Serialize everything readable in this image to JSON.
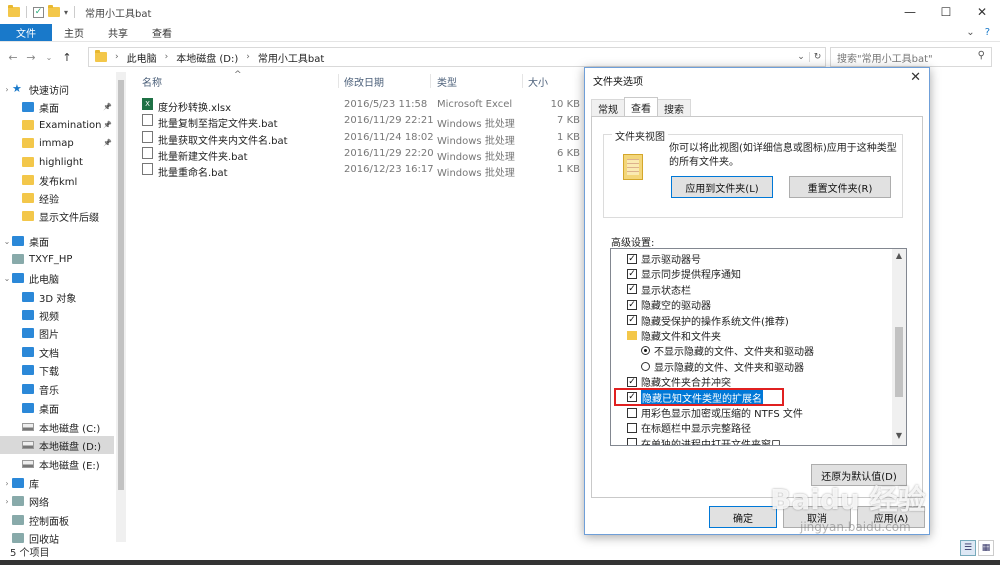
{
  "window": {
    "title": "常用小工具bat",
    "controls": {
      "minimize": "—",
      "maximize": "☐",
      "close": "✕"
    }
  },
  "ribbon": {
    "tabs": [
      "文件",
      "主页",
      "共享",
      "查看"
    ],
    "collapse": "⌄",
    "help": "?"
  },
  "address": {
    "crumbs": [
      "此电脑",
      "本地磁盘 (D:)",
      "常用小工具bat"
    ],
    "dropdown": "⌄",
    "refresh": "↻",
    "search_placeholder": "搜索\"常用小工具bat\""
  },
  "sidebar": {
    "items": [
      {
        "label": "快速访问",
        "icon": "star-icon"
      },
      {
        "label": "桌面",
        "icon": "desktop-icon",
        "pinned": true
      },
      {
        "label": "Examination",
        "icon": "folder-icon",
        "pinned": true
      },
      {
        "label": "immap",
        "icon": "folder-icon",
        "pinned": true
      },
      {
        "label": "highlight",
        "icon": "folder-icon"
      },
      {
        "label": "发布kml",
        "icon": "folder-icon"
      },
      {
        "label": "经验",
        "icon": "folder-icon"
      },
      {
        "label": "显示文件后缀",
        "icon": "folder-icon"
      },
      {
        "label": "桌面",
        "icon": "desktop-icon"
      },
      {
        "label": "TXYF_HP",
        "icon": "user-icon"
      },
      {
        "label": "此电脑",
        "icon": "computer-icon"
      },
      {
        "label": "3D 对象",
        "icon": "3d-objects-icon"
      },
      {
        "label": "视频",
        "icon": "video-icon"
      },
      {
        "label": "图片",
        "icon": "pictures-icon"
      },
      {
        "label": "文档",
        "icon": "documents-icon"
      },
      {
        "label": "下载",
        "icon": "download-icon"
      },
      {
        "label": "音乐",
        "icon": "music-icon"
      },
      {
        "label": "桌面",
        "icon": "desktop-icon"
      },
      {
        "label": "本地磁盘 (C:)",
        "icon": "drive-icon"
      },
      {
        "label": "本地磁盘 (D:)",
        "icon": "drive-icon",
        "selected": true
      },
      {
        "label": "本地磁盘 (E:)",
        "icon": "drive-icon"
      },
      {
        "label": "库",
        "icon": "library-icon"
      },
      {
        "label": "网络",
        "icon": "network-icon"
      },
      {
        "label": "控制面板",
        "icon": "control-panel-icon"
      },
      {
        "label": "回收站",
        "icon": "recycle-bin-icon"
      }
    ]
  },
  "filelist": {
    "columns": {
      "name": "名称",
      "date": "修改日期",
      "type": "类型",
      "size": "大小"
    },
    "rows": [
      {
        "name": "度分秒转换.xlsx",
        "date": "2016/5/23 11:58",
        "type": "Microsoft Excel",
        "size": "10 KB",
        "icon": "excel-icon"
      },
      {
        "name": "批量复制至指定文件夹.bat",
        "date": "2016/11/29 22:21",
        "type": "Windows 批处理",
        "size": "7 KB",
        "icon": "bat-icon"
      },
      {
        "name": "批量获取文件夹内文件名.bat",
        "date": "2016/11/24 18:02",
        "type": "Windows 批处理",
        "size": "1 KB",
        "icon": "bat-icon"
      },
      {
        "name": "批量新建文件夹.bat",
        "date": "2016/11/29 22:20",
        "type": "Windows 批处理",
        "size": "6 KB",
        "icon": "bat-icon"
      },
      {
        "name": "批量重命名.bat",
        "date": "2016/12/23 16:17",
        "type": "Windows 批处理",
        "size": "1 KB",
        "icon": "bat-icon"
      }
    ]
  },
  "status": {
    "count": "5 个项目"
  },
  "dialog": {
    "title": "文件夹选项",
    "close": "✕",
    "tabs": [
      "常规",
      "查看",
      "搜索"
    ],
    "active_tab": "查看",
    "folder_view": {
      "title": "文件夹视图",
      "description": "你可以将此视图(如详细信息或图标)应用于这种类型的所有文件夹。",
      "apply_button": "应用到文件夹(L)",
      "reset_button": "重置文件夹(R)"
    },
    "advanced_label": "高级设置:",
    "settings": [
      {
        "kind": "checkbox",
        "checked": true,
        "label": "显示驱动器号"
      },
      {
        "kind": "checkbox",
        "checked": true,
        "label": "显示同步提供程序通知"
      },
      {
        "kind": "checkbox",
        "checked": true,
        "label": "显示状态栏"
      },
      {
        "kind": "checkbox",
        "checked": true,
        "label": "隐藏空的驱动器"
      },
      {
        "kind": "checkbox",
        "checked": true,
        "label": "隐藏受保护的操作系统文件(推荐)"
      },
      {
        "kind": "folder",
        "label": "隐藏文件和文件夹"
      },
      {
        "kind": "radio",
        "checked": true,
        "label": "不显示隐藏的文件、文件夹和驱动器"
      },
      {
        "kind": "radio",
        "checked": false,
        "label": "显示隐藏的文件、文件夹和驱动器"
      },
      {
        "kind": "checkbox",
        "checked": true,
        "label": "隐藏文件夹合并冲突"
      },
      {
        "kind": "checkbox",
        "checked": true,
        "label": "隐藏已知文件类型的扩展名",
        "highlighted": true
      },
      {
        "kind": "checkbox",
        "checked": false,
        "label": "用彩色显示加密或压缩的 NTFS 文件"
      },
      {
        "kind": "checkbox",
        "checked": false,
        "label": "在标题栏中显示完整路径"
      },
      {
        "kind": "checkbox",
        "checked": false,
        "label": "在单独的进程中打开文件夹窗口"
      }
    ],
    "restore_defaults": "还原为默认值(D)",
    "ok": "确定",
    "cancel": "取消",
    "apply": "应用(A)"
  },
  "watermark": {
    "text1": "Baidu 经验",
    "text2": "jingyan.baidu.com"
  },
  "colors": {
    "accent": "#1979ca",
    "selection": "#0078d7",
    "highlight_box": "#e02020",
    "folder": "#f3c74a"
  }
}
